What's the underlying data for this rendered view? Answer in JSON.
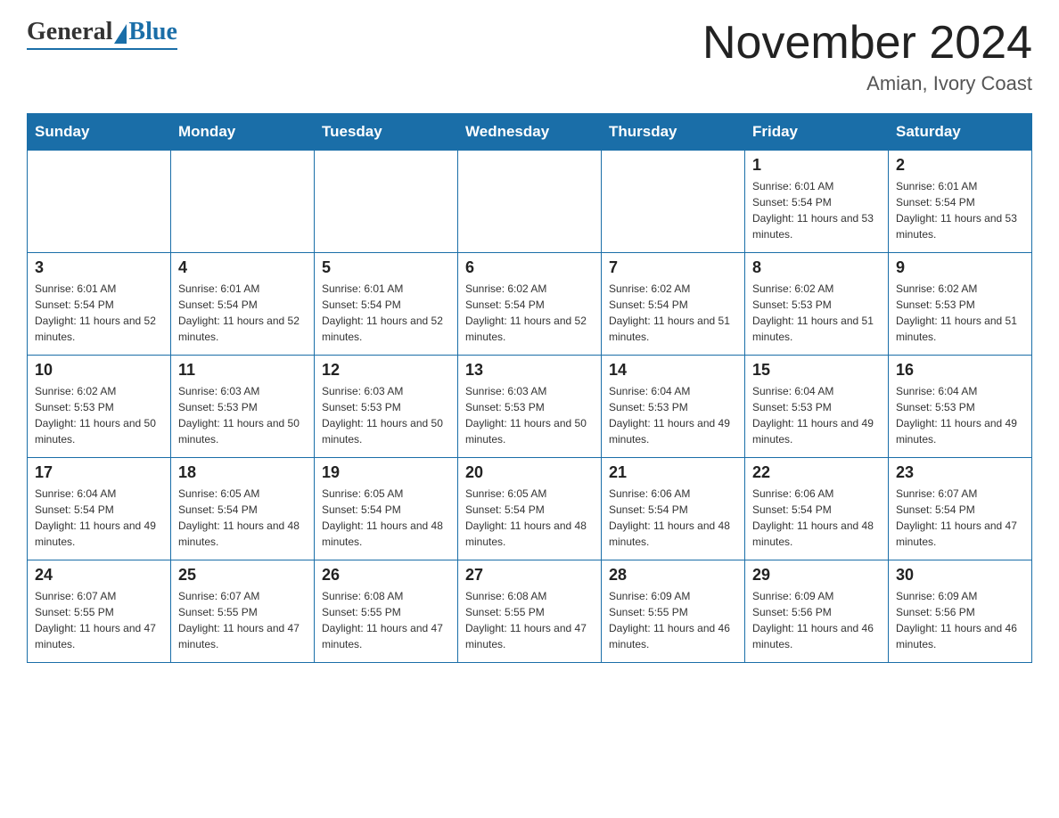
{
  "header": {
    "logo_general": "General",
    "logo_blue": "Blue",
    "month_title": "November 2024",
    "location": "Amian, Ivory Coast"
  },
  "days_of_week": [
    "Sunday",
    "Monday",
    "Tuesday",
    "Wednesday",
    "Thursday",
    "Friday",
    "Saturday"
  ],
  "weeks": [
    [
      {
        "day": "",
        "info": ""
      },
      {
        "day": "",
        "info": ""
      },
      {
        "day": "",
        "info": ""
      },
      {
        "day": "",
        "info": ""
      },
      {
        "day": "",
        "info": ""
      },
      {
        "day": "1",
        "info": "Sunrise: 6:01 AM\nSunset: 5:54 PM\nDaylight: 11 hours and 53 minutes."
      },
      {
        "day": "2",
        "info": "Sunrise: 6:01 AM\nSunset: 5:54 PM\nDaylight: 11 hours and 53 minutes."
      }
    ],
    [
      {
        "day": "3",
        "info": "Sunrise: 6:01 AM\nSunset: 5:54 PM\nDaylight: 11 hours and 52 minutes."
      },
      {
        "day": "4",
        "info": "Sunrise: 6:01 AM\nSunset: 5:54 PM\nDaylight: 11 hours and 52 minutes."
      },
      {
        "day": "5",
        "info": "Sunrise: 6:01 AM\nSunset: 5:54 PM\nDaylight: 11 hours and 52 minutes."
      },
      {
        "day": "6",
        "info": "Sunrise: 6:02 AM\nSunset: 5:54 PM\nDaylight: 11 hours and 52 minutes."
      },
      {
        "day": "7",
        "info": "Sunrise: 6:02 AM\nSunset: 5:54 PM\nDaylight: 11 hours and 51 minutes."
      },
      {
        "day": "8",
        "info": "Sunrise: 6:02 AM\nSunset: 5:53 PM\nDaylight: 11 hours and 51 minutes."
      },
      {
        "day": "9",
        "info": "Sunrise: 6:02 AM\nSunset: 5:53 PM\nDaylight: 11 hours and 51 minutes."
      }
    ],
    [
      {
        "day": "10",
        "info": "Sunrise: 6:02 AM\nSunset: 5:53 PM\nDaylight: 11 hours and 50 minutes."
      },
      {
        "day": "11",
        "info": "Sunrise: 6:03 AM\nSunset: 5:53 PM\nDaylight: 11 hours and 50 minutes."
      },
      {
        "day": "12",
        "info": "Sunrise: 6:03 AM\nSunset: 5:53 PM\nDaylight: 11 hours and 50 minutes."
      },
      {
        "day": "13",
        "info": "Sunrise: 6:03 AM\nSunset: 5:53 PM\nDaylight: 11 hours and 50 minutes."
      },
      {
        "day": "14",
        "info": "Sunrise: 6:04 AM\nSunset: 5:53 PM\nDaylight: 11 hours and 49 minutes."
      },
      {
        "day": "15",
        "info": "Sunrise: 6:04 AM\nSunset: 5:53 PM\nDaylight: 11 hours and 49 minutes."
      },
      {
        "day": "16",
        "info": "Sunrise: 6:04 AM\nSunset: 5:53 PM\nDaylight: 11 hours and 49 minutes."
      }
    ],
    [
      {
        "day": "17",
        "info": "Sunrise: 6:04 AM\nSunset: 5:54 PM\nDaylight: 11 hours and 49 minutes."
      },
      {
        "day": "18",
        "info": "Sunrise: 6:05 AM\nSunset: 5:54 PM\nDaylight: 11 hours and 48 minutes."
      },
      {
        "day": "19",
        "info": "Sunrise: 6:05 AM\nSunset: 5:54 PM\nDaylight: 11 hours and 48 minutes."
      },
      {
        "day": "20",
        "info": "Sunrise: 6:05 AM\nSunset: 5:54 PM\nDaylight: 11 hours and 48 minutes."
      },
      {
        "day": "21",
        "info": "Sunrise: 6:06 AM\nSunset: 5:54 PM\nDaylight: 11 hours and 48 minutes."
      },
      {
        "day": "22",
        "info": "Sunrise: 6:06 AM\nSunset: 5:54 PM\nDaylight: 11 hours and 48 minutes."
      },
      {
        "day": "23",
        "info": "Sunrise: 6:07 AM\nSunset: 5:54 PM\nDaylight: 11 hours and 47 minutes."
      }
    ],
    [
      {
        "day": "24",
        "info": "Sunrise: 6:07 AM\nSunset: 5:55 PM\nDaylight: 11 hours and 47 minutes."
      },
      {
        "day": "25",
        "info": "Sunrise: 6:07 AM\nSunset: 5:55 PM\nDaylight: 11 hours and 47 minutes."
      },
      {
        "day": "26",
        "info": "Sunrise: 6:08 AM\nSunset: 5:55 PM\nDaylight: 11 hours and 47 minutes."
      },
      {
        "day": "27",
        "info": "Sunrise: 6:08 AM\nSunset: 5:55 PM\nDaylight: 11 hours and 47 minutes."
      },
      {
        "day": "28",
        "info": "Sunrise: 6:09 AM\nSunset: 5:55 PM\nDaylight: 11 hours and 46 minutes."
      },
      {
        "day": "29",
        "info": "Sunrise: 6:09 AM\nSunset: 5:56 PM\nDaylight: 11 hours and 46 minutes."
      },
      {
        "day": "30",
        "info": "Sunrise: 6:09 AM\nSunset: 5:56 PM\nDaylight: 11 hours and 46 minutes."
      }
    ]
  ]
}
